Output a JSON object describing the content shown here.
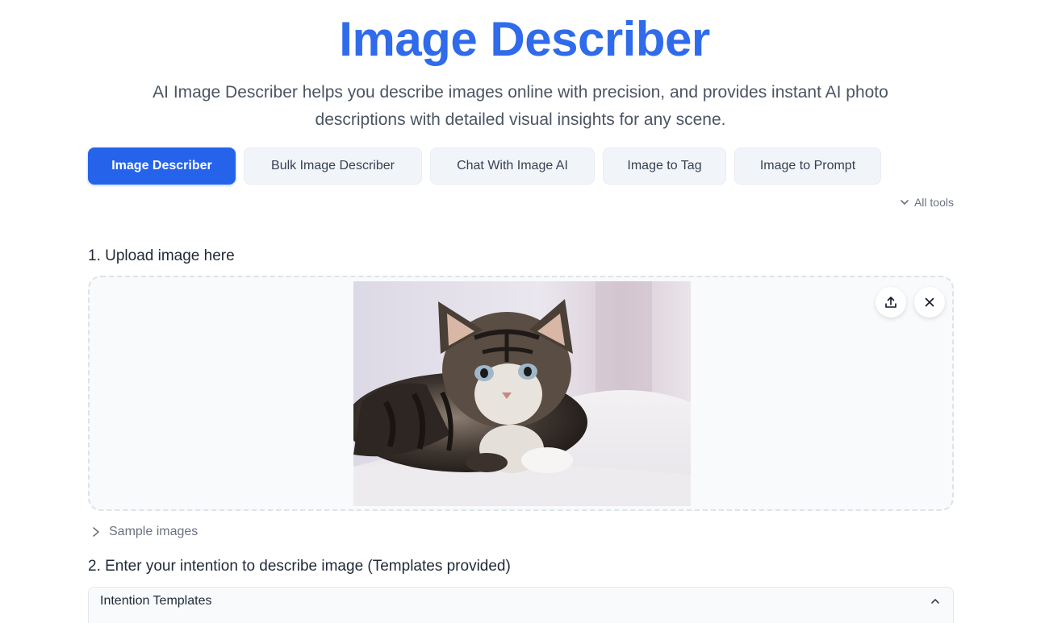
{
  "header": {
    "title": "Image Describer",
    "subtitle": "AI Image Describer helps you describe images online with precision, and provides instant AI photo descriptions with detailed visual insights for any scene."
  },
  "tabs": [
    {
      "label": "Image Describer",
      "active": true
    },
    {
      "label": "Bulk Image Describer",
      "active": false
    },
    {
      "label": "Chat With Image AI",
      "active": false
    },
    {
      "label": "Image to Tag",
      "active": false
    },
    {
      "label": "Image to Prompt",
      "active": false
    }
  ],
  "all_tools_label": "All tools",
  "upload": {
    "step_label": "1. Upload image here",
    "image_subject": "tabby kitten on white blanket",
    "upload_icon": "upload-icon",
    "close_icon": "close-icon"
  },
  "sample_images_label": "Sample images",
  "intention": {
    "step_label": "2. Enter your intention to describe image (Templates provided)",
    "templates_label": "Intention Templates"
  },
  "colors": {
    "accent": "#2563eb",
    "title": "#2f6bea"
  }
}
